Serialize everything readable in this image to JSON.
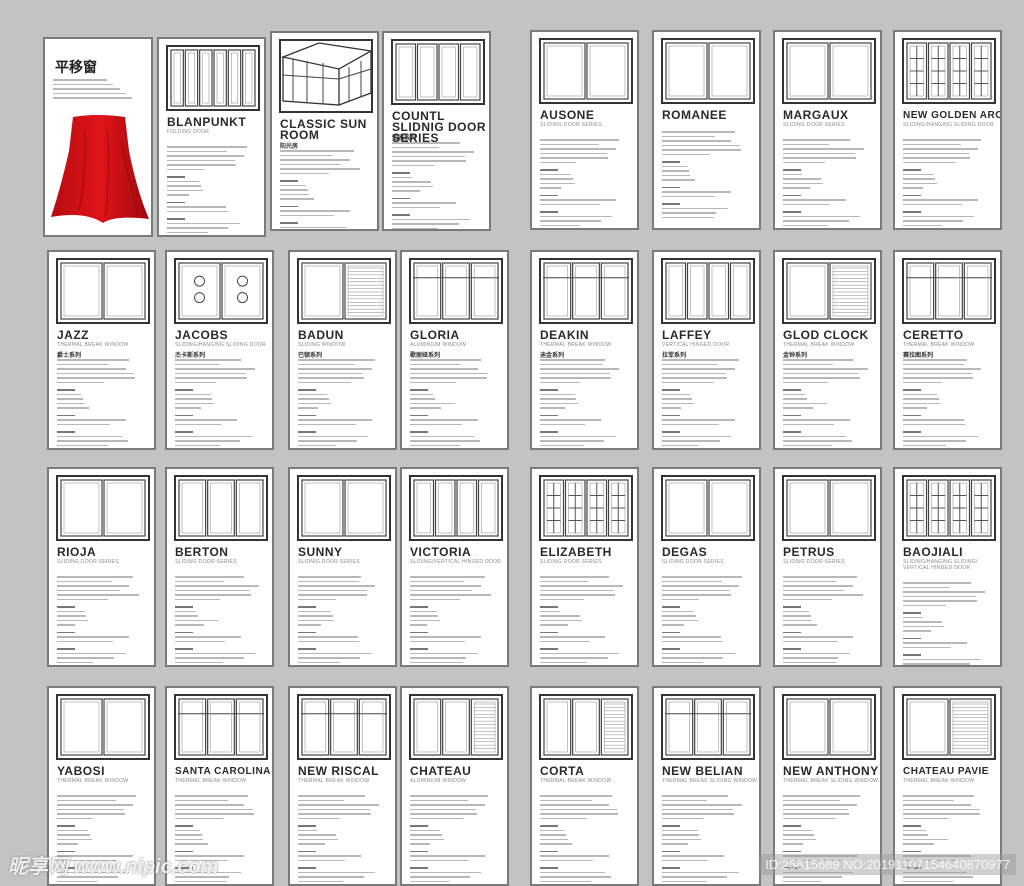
{
  "colors": {
    "background": "#c3c3c3",
    "card_border": "#7a7a7a",
    "cloth": "#e0141a"
  },
  "intro_card": {
    "title": "平移窗",
    "icon": "red-cloth-image"
  },
  "cards": [
    {
      "title": "BLANPUNKT",
      "subtitle": "FOLDING DOOR",
      "cn": "",
      "panels": 6,
      "icon": "folding-door-icon"
    },
    {
      "title": "CLASSIC SUN ROOM",
      "subtitle": "",
      "cn": "阳光房",
      "panels": 0,
      "icon": "sun-room-icon"
    },
    {
      "title": "COUNTL SLIDNIG DOOR SERIES",
      "subtitle": "",
      "cn": "铂雅系列",
      "panels": 4,
      "icon": "sliding-door-icon"
    },
    {
      "title": "AUSONE",
      "subtitle": "SLIDING DOOR SERIES",
      "cn": "",
      "panels": 2,
      "icon": "sliding-door-icon"
    },
    {
      "title": "ROMANEE",
      "subtitle": "",
      "cn": "",
      "panels": 2,
      "icon": "sliding-window-icon"
    },
    {
      "title": "MARGAUX",
      "subtitle": "SLIDING DOOR SERIES",
      "cn": "",
      "panels": 2,
      "icon": "sliding-door-icon"
    },
    {
      "title": "NEW GOLDEN ARC",
      "subtitle": "SLIDING/HANGING SLIDING DOOR",
      "cn": "",
      "panels": 4,
      "icon": "grid-door-icon"
    },
    {
      "title": "JAZZ",
      "subtitle": "THERMAL BREAK WINDOW",
      "cn": "爵士系列",
      "panels": 2,
      "icon": "window-icon"
    },
    {
      "title": "JACOBS",
      "subtitle": "SLIDING/HANGING SLIDING DOOR",
      "cn": "杰卡斯系列",
      "panels": 2,
      "icon": "decorated-door-icon"
    },
    {
      "title": "BADUN",
      "subtitle": "SLIDING WINDOW",
      "cn": "巴顿系列",
      "panels": 2,
      "icon": "screen-window-icon"
    },
    {
      "title": "GLORIA",
      "subtitle": "ALUMINIUM WINDOW",
      "cn": "歌丽娅系列",
      "panels": 3,
      "icon": "window-icon"
    },
    {
      "title": "DEAKIN",
      "subtitle": "THERMAL BREAK WINDOW",
      "cn": "迪金系列",
      "panels": 3,
      "icon": "window-icon"
    },
    {
      "title": "LAFFEY",
      "subtitle": "VERTICAL HINGED DOOR",
      "cn": "拉菲系列",
      "panels": 4,
      "icon": "hinged-door-icon"
    },
    {
      "title": "GLOD CLOCK",
      "subtitle": "THERMAL BREAK WINDOW",
      "cn": "金钟系列",
      "panels": 2,
      "icon": "screen-window-icon"
    },
    {
      "title": "CERETTO",
      "subtitle": "THERMAL BREAK WINDOW",
      "cn": "赛拉图系列",
      "panels": 3,
      "icon": "window-icon"
    },
    {
      "title": "RIOJA",
      "subtitle": "SLIDING DOOR SERIES",
      "cn": "",
      "panels": 2,
      "icon": "sliding-door-icon"
    },
    {
      "title": "BERTON",
      "subtitle": "SLIDING DOOR SERIES",
      "cn": "",
      "panels": 3,
      "icon": "sliding-door-icon"
    },
    {
      "title": "SUNNY",
      "subtitle": "SLIDNIG DOOR SERIES",
      "cn": "",
      "panels": 2,
      "icon": "sliding-door-icon"
    },
    {
      "title": "VICTORIA",
      "subtitle": "SLIDING/VERTICAL HINGED DOOR",
      "cn": "",
      "panels": 4,
      "icon": "hinged-door-icon"
    },
    {
      "title": "ELIZABETH",
      "subtitle": "SLIDING DOOR SERIES",
      "cn": "",
      "panels": 4,
      "icon": "grid-door-icon"
    },
    {
      "title": "DEGAS",
      "subtitle": "SLIDING DOOR SERIES",
      "cn": "",
      "panels": 2,
      "icon": "sliding-door-icon"
    },
    {
      "title": "PETRUS",
      "subtitle": "SLIDING DOOR SERIES",
      "cn": "",
      "panels": 2,
      "icon": "sliding-door-icon"
    },
    {
      "title": "BAOJIALI",
      "subtitle": "SLIDING/HANGING SLIDING/ VERTICAL HINGED DOOR",
      "cn": "",
      "panels": 4,
      "icon": "grid-door-icon"
    },
    {
      "title": "YABOSI",
      "subtitle": "THERMAL BREAK WINDOW",
      "cn": "",
      "panels": 2,
      "icon": "window-icon"
    },
    {
      "title": "SANTA CAROLINA",
      "subtitle": "THERMAL BREAK WINDOW",
      "cn": "",
      "panels": 3,
      "icon": "window-icon"
    },
    {
      "title": "NEW RISCAL",
      "subtitle": "THERMAL BREAK WINDOW",
      "cn": "",
      "panels": 3,
      "icon": "window-icon"
    },
    {
      "title": "CHATEAU",
      "subtitle": "ALUMINIUM WINDOW",
      "cn": "",
      "panels": 3,
      "icon": "screen-window-icon"
    },
    {
      "title": "CORTA",
      "subtitle": "THERMAL BREAK WINDOW",
      "cn": "",
      "panels": 3,
      "icon": "screen-window-icon"
    },
    {
      "title": "NEW BELIAN",
      "subtitle": "THERMAL BREAK SLIDING WINDOW",
      "cn": "",
      "panels": 3,
      "icon": "window-icon"
    },
    {
      "title": "NEW ANTHONY",
      "subtitle": "THERMAL BREAK SLIDING WINDOW",
      "cn": "",
      "panels": 2,
      "icon": "window-icon"
    },
    {
      "title": "CHATEAU PAVIE",
      "subtitle": "THERMAL BREAK WINDOW",
      "cn": "",
      "panels": 2,
      "icon": "screen-window-icon"
    }
  ],
  "watermark": {
    "site": "昵享网 www.nipic.com",
    "id": "ID:25815689 NO:20191107154640870977"
  }
}
